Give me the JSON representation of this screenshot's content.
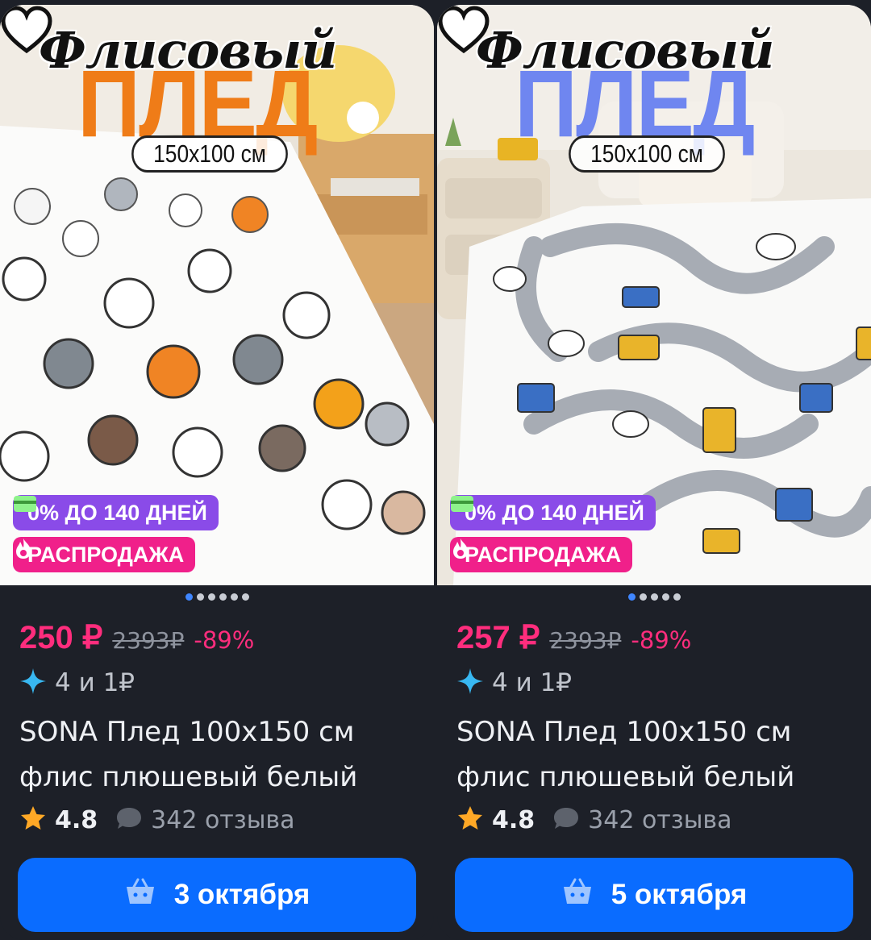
{
  "cards": [
    {
      "title_script": "Флисовый",
      "title_big": "ПЛЕД",
      "title_big_color": "#ef7c18",
      "size_label": "150x100 см",
      "badge_installment": "0% ДО 140 ДНЕЙ",
      "badge_sale": "РАСПРОДАЖА",
      "price": "250 ₽",
      "old_price": "2393₽",
      "discount": "-89%",
      "bonus": "4 и 1₽",
      "title_line1": "SONA Плед 100x150 см",
      "title_line2": "флис плюшевый белый",
      "rating": "4.8",
      "reviews": "342 отзыва",
      "delivery": "3 октября",
      "image_count": 6,
      "active_image": 0
    },
    {
      "title_script": "Флисовый",
      "title_big": "ПЛЕД",
      "title_big_color": "#6f86f0",
      "size_label": "150x100 см",
      "badge_installment": "0% ДО 140 ДНЕЙ",
      "badge_sale": "РАСПРОДАЖА",
      "price": "257 ₽",
      "old_price": "2393₽",
      "discount": "-89%",
      "bonus": "4 и 1₽",
      "title_line1": "SONA Плед 100x150 см",
      "title_line2": "флис плюшевый белый",
      "rating": "4.8",
      "reviews": "342 отзыва",
      "delivery": "5 октября",
      "image_count": 5,
      "active_image": 0
    }
  ],
  "colors": {
    "price": "#ff2d7d",
    "badge_installment": "#8a4be8",
    "badge_sale": "#f0208a",
    "button": "#0a6cff",
    "background": "#1d2028"
  },
  "icons": [
    "heart-icon",
    "card-icon",
    "fire-icon",
    "sparkle-icon",
    "star-icon",
    "comment-icon",
    "basket-icon"
  ]
}
